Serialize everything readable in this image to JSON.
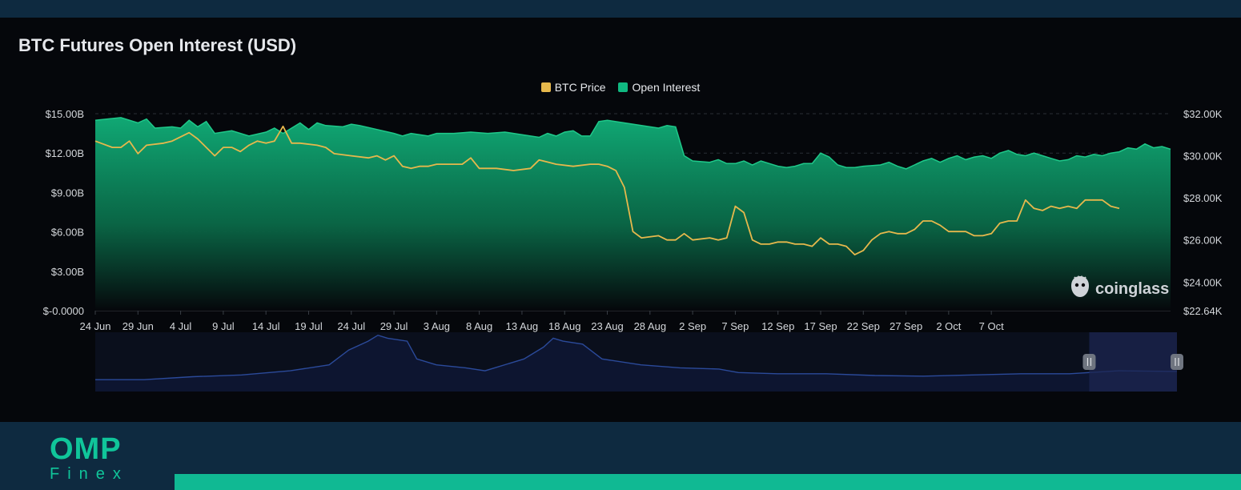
{
  "colors": {
    "page_bg": "#0e2a40",
    "chart_bg": "#05070b",
    "btc_price": "#e6b84c",
    "open_interest": "#10b981",
    "brand": "#10c59a",
    "navigator_line": "#2b4a9a",
    "navigator_selection": "#1c2550"
  },
  "chart_title": "BTC Futures Open Interest (USD)",
  "legend": [
    {
      "label": "BTC Price",
      "color": "#e6b84c"
    },
    {
      "label": "Open Interest",
      "color": "#10b981"
    }
  ],
  "watermark": {
    "icon": "coinglass-logo-icon",
    "text": "coinglass"
  },
  "brand": {
    "name": "OMP",
    "sub": "Finex"
  },
  "chart_data": {
    "type": "area",
    "title": "BTC Futures Open Interest (USD)",
    "x_labels": [
      "24 Jun",
      "29 Jun",
      "4 Jul",
      "9 Jul",
      "14 Jul",
      "19 Jul",
      "24 Jul",
      "29 Jul",
      "3 Aug",
      "8 Aug",
      "13 Aug",
      "18 Aug",
      "23 Aug",
      "28 Aug",
      "2 Sep",
      "7 Sep",
      "12 Sep",
      "17 Sep",
      "22 Sep",
      "27 Sep",
      "2 Oct",
      "7 Oct"
    ],
    "x_range_days": [
      0,
      111
    ],
    "y_left": {
      "label": "Open Interest",
      "ticks": [
        "$15.00B",
        "$12.00B",
        "$9.00B",
        "$6.00B",
        "$3.00B",
        "$-0.0000"
      ],
      "min": 0,
      "max": 15
    },
    "y_right": {
      "label": "BTC Price",
      "ticks": [
        "$32.00K",
        "$30.00K",
        "$28.00K",
        "$26.00K",
        "$24.00K",
        "$22.64K"
      ],
      "min": 22.64,
      "max": 32
    },
    "grid": true,
    "legend_position": "top-center",
    "series": [
      {
        "name": "Open Interest",
        "unit": "USD billions",
        "axis": "left",
        "points": [
          [
            0,
            14.5
          ],
          [
            3,
            14.7
          ],
          [
            5,
            14.3
          ],
          [
            6,
            14.6
          ],
          [
            7,
            13.9
          ],
          [
            9,
            14.0
          ],
          [
            10,
            13.9
          ],
          [
            11,
            14.5
          ],
          [
            12,
            14.0
          ],
          [
            13,
            14.4
          ],
          [
            14,
            13.5
          ],
          [
            16,
            13.7
          ],
          [
            18,
            13.3
          ],
          [
            20,
            13.6
          ],
          [
            21,
            13.9
          ],
          [
            22,
            13.5
          ],
          [
            23,
            13.9
          ],
          [
            24,
            14.3
          ],
          [
            25,
            13.8
          ],
          [
            26,
            14.3
          ],
          [
            27,
            14.1
          ],
          [
            29,
            14.0
          ],
          [
            30,
            14.2
          ],
          [
            31,
            14.1
          ],
          [
            33,
            13.8
          ],
          [
            35,
            13.5
          ],
          [
            36,
            13.3
          ],
          [
            37,
            13.5
          ],
          [
            39,
            13.3
          ],
          [
            40,
            13.5
          ],
          [
            42,
            13.5
          ],
          [
            44,
            13.6
          ],
          [
            46,
            13.5
          ],
          [
            48,
            13.6
          ],
          [
            50,
            13.4
          ],
          [
            52,
            13.2
          ],
          [
            53,
            13.5
          ],
          [
            54,
            13.3
          ],
          [
            55,
            13.6
          ],
          [
            56,
            13.7
          ],
          [
            57,
            13.3
          ],
          [
            58,
            13.3
          ],
          [
            59,
            14.4
          ],
          [
            60,
            14.5
          ],
          [
            62,
            14.3
          ],
          [
            64,
            14.1
          ],
          [
            66,
            13.9
          ],
          [
            67,
            14.1
          ],
          [
            68,
            14.0
          ],
          [
            69,
            11.8
          ],
          [
            70,
            11.4
          ],
          [
            72,
            11.3
          ],
          [
            73,
            11.5
          ],
          [
            74,
            11.2
          ],
          [
            75,
            11.2
          ],
          [
            76,
            11.4
          ],
          [
            77,
            11.1
          ],
          [
            78,
            11.4
          ],
          [
            79,
            11.2
          ],
          [
            80,
            11.0
          ],
          [
            81,
            10.9
          ],
          [
            82,
            11.0
          ],
          [
            83,
            11.2
          ],
          [
            84,
            11.2
          ],
          [
            85,
            12.0
          ],
          [
            86,
            11.7
          ],
          [
            87,
            11.1
          ],
          [
            88,
            10.9
          ],
          [
            89,
            10.9
          ],
          [
            90,
            11.0
          ],
          [
            92,
            11.1
          ],
          [
            93,
            11.3
          ],
          [
            94,
            11.0
          ],
          [
            95,
            10.8
          ],
          [
            96,
            11.1
          ],
          [
            97,
            11.4
          ],
          [
            98,
            11.6
          ],
          [
            99,
            11.3
          ],
          [
            100,
            11.6
          ],
          [
            101,
            11.8
          ],
          [
            102,
            11.5
          ],
          [
            103,
            11.7
          ],
          [
            104,
            11.8
          ],
          [
            105,
            11.6
          ],
          [
            106,
            12.0
          ],
          [
            107,
            12.2
          ],
          [
            108,
            11.9
          ],
          [
            109,
            11.8
          ],
          [
            110,
            12.0
          ],
          [
            111,
            11.8
          ],
          [
            112,
            11.6
          ],
          [
            113,
            11.4
          ],
          [
            114,
            11.5
          ],
          [
            115,
            11.8
          ],
          [
            116,
            11.7
          ],
          [
            117,
            11.9
          ],
          [
            118,
            11.8
          ],
          [
            119,
            12.0
          ],
          [
            120,
            12.1
          ],
          [
            121,
            12.4
          ],
          [
            122,
            12.3
          ],
          [
            123,
            12.7
          ],
          [
            124,
            12.4
          ],
          [
            125,
            12.5
          ],
          [
            126,
            12.3
          ]
        ]
      },
      {
        "name": "BTC Price",
        "unit": "USD thousands",
        "axis": "right",
        "points": [
          [
            0,
            30.7
          ],
          [
            2,
            30.4
          ],
          [
            3,
            30.4
          ],
          [
            4,
            30.7
          ],
          [
            5,
            30.1
          ],
          [
            6,
            30.5
          ],
          [
            8,
            30.6
          ],
          [
            9,
            30.7
          ],
          [
            10,
            30.9
          ],
          [
            11,
            31.1
          ],
          [
            12,
            30.8
          ],
          [
            13,
            30.4
          ],
          [
            14,
            30.0
          ],
          [
            15,
            30.4
          ],
          [
            16,
            30.4
          ],
          [
            17,
            30.2
          ],
          [
            18,
            30.5
          ],
          [
            19,
            30.7
          ],
          [
            20,
            30.6
          ],
          [
            21,
            30.7
          ],
          [
            22,
            31.4
          ],
          [
            23,
            30.6
          ],
          [
            24,
            30.6
          ],
          [
            26,
            30.5
          ],
          [
            27,
            30.4
          ],
          [
            28,
            30.1
          ],
          [
            30,
            30.0
          ],
          [
            32,
            29.9
          ],
          [
            33,
            30.0
          ],
          [
            34,
            29.8
          ],
          [
            35,
            30.0
          ],
          [
            36,
            29.5
          ],
          [
            37,
            29.4
          ],
          [
            38,
            29.5
          ],
          [
            39,
            29.5
          ],
          [
            40,
            29.6
          ],
          [
            42,
            29.6
          ],
          [
            43,
            29.6
          ],
          [
            44,
            29.9
          ],
          [
            45,
            29.4
          ],
          [
            47,
            29.4
          ],
          [
            49,
            29.3
          ],
          [
            51,
            29.4
          ],
          [
            52,
            29.8
          ],
          [
            53,
            29.7
          ],
          [
            54,
            29.6
          ],
          [
            56,
            29.5
          ],
          [
            58,
            29.6
          ],
          [
            59,
            29.6
          ],
          [
            60,
            29.5
          ],
          [
            61,
            29.3
          ],
          [
            62,
            28.5
          ],
          [
            63,
            26.4
          ],
          [
            64,
            26.1
          ],
          [
            66,
            26.2
          ],
          [
            67,
            26.0
          ],
          [
            68,
            26.0
          ],
          [
            69,
            26.3
          ],
          [
            70,
            26.0
          ],
          [
            72,
            26.1
          ],
          [
            73,
            26.0
          ],
          [
            74,
            26.1
          ],
          [
            75,
            27.6
          ],
          [
            76,
            27.3
          ],
          [
            77,
            26.0
          ],
          [
            78,
            25.8
          ],
          [
            79,
            25.8
          ],
          [
            80,
            25.9
          ],
          [
            81,
            25.9
          ],
          [
            82,
            25.8
          ],
          [
            83,
            25.8
          ],
          [
            84,
            25.7
          ],
          [
            85,
            26.1
          ],
          [
            86,
            25.8
          ],
          [
            87,
            25.8
          ],
          [
            88,
            25.7
          ],
          [
            89,
            25.3
          ],
          [
            90,
            25.5
          ],
          [
            91,
            26.0
          ],
          [
            92,
            26.3
          ],
          [
            93,
            26.4
          ],
          [
            94,
            26.3
          ],
          [
            95,
            26.3
          ],
          [
            96,
            26.5
          ],
          [
            97,
            26.9
          ],
          [
            98,
            26.9
          ],
          [
            99,
            26.7
          ],
          [
            100,
            26.4
          ],
          [
            101,
            26.4
          ],
          [
            102,
            26.4
          ],
          [
            103,
            26.2
          ],
          [
            104,
            26.2
          ],
          [
            105,
            26.3
          ],
          [
            106,
            26.8
          ],
          [
            107,
            26.9
          ],
          [
            108,
            26.9
          ],
          [
            109,
            27.9
          ],
          [
            110,
            27.5
          ],
          [
            111,
            27.4
          ],
          [
            112,
            27.6
          ],
          [
            113,
            27.5
          ],
          [
            114,
            27.6
          ],
          [
            115,
            27.5
          ],
          [
            116,
            27.9
          ],
          [
            117,
            27.9
          ],
          [
            118,
            27.9
          ],
          [
            119,
            27.6
          ],
          [
            120,
            27.5
          ]
        ]
      }
    ],
    "navigator": {
      "points": [
        [
          0,
          0.2
        ],
        [
          5,
          0.2
        ],
        [
          10,
          0.25
        ],
        [
          15,
          0.28
        ],
        [
          20,
          0.35
        ],
        [
          24,
          0.45
        ],
        [
          26,
          0.7
        ],
        [
          28,
          0.85
        ],
        [
          29,
          0.95
        ],
        [
          30,
          0.9
        ],
        [
          32,
          0.85
        ],
        [
          33,
          0.55
        ],
        [
          35,
          0.45
        ],
        [
          38,
          0.4
        ],
        [
          40,
          0.35
        ],
        [
          44,
          0.55
        ],
        [
          46,
          0.75
        ],
        [
          47,
          0.9
        ],
        [
          48,
          0.85
        ],
        [
          50,
          0.8
        ],
        [
          52,
          0.55
        ],
        [
          56,
          0.45
        ],
        [
          60,
          0.4
        ],
        [
          64,
          0.38
        ],
        [
          66,
          0.32
        ],
        [
          70,
          0.3
        ],
        [
          75,
          0.3
        ],
        [
          80,
          0.27
        ],
        [
          85,
          0.26
        ],
        [
          90,
          0.28
        ],
        [
          95,
          0.3
        ],
        [
          100,
          0.3
        ],
        [
          105,
          0.35
        ],
        [
          110,
          0.34
        ],
        [
          111,
          0.34
        ]
      ],
      "selection_days": [
        102,
        111
      ]
    }
  }
}
